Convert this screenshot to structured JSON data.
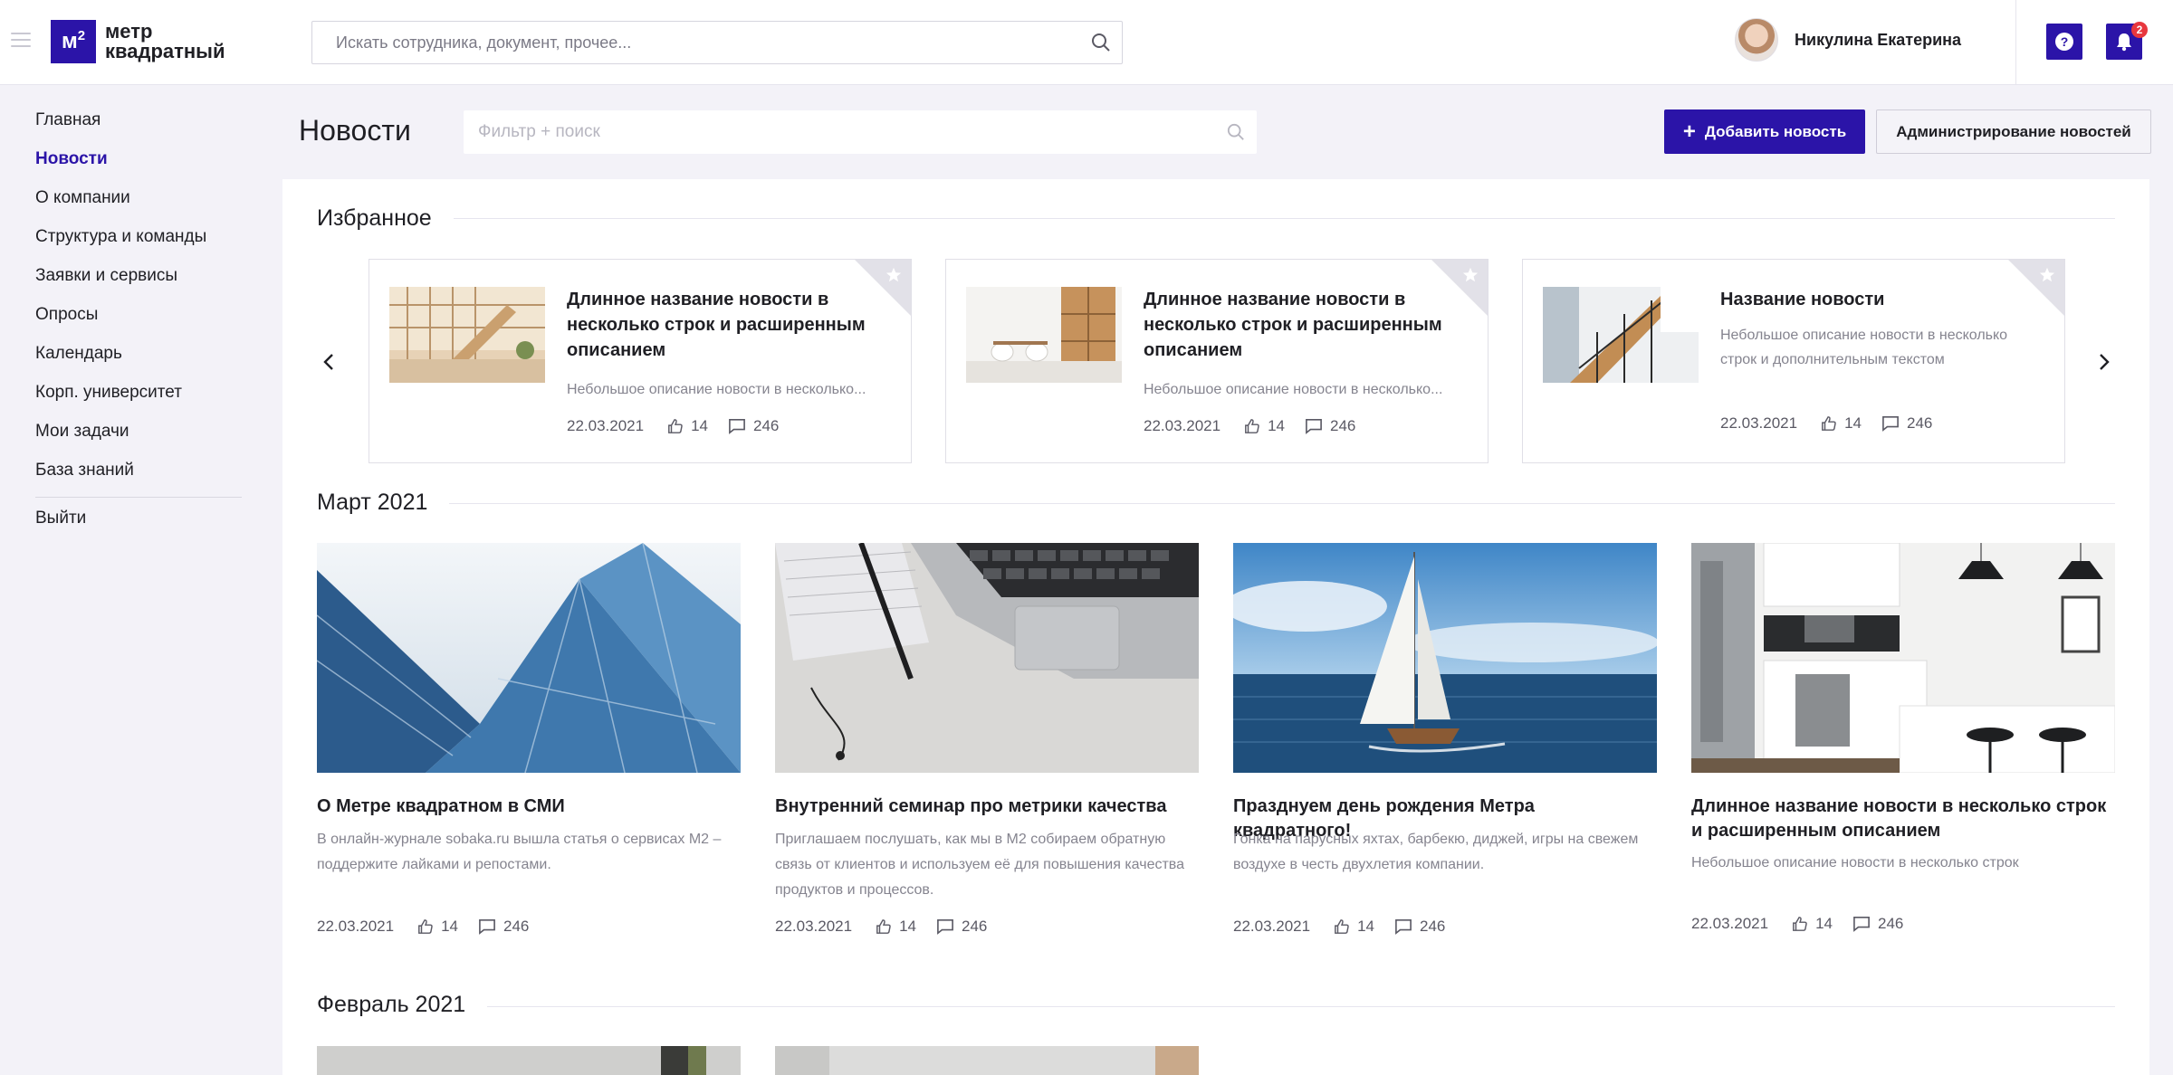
{
  "app": {
    "logo_line1": "метр",
    "logo_line2": "квадратный",
    "logo_mark": "м",
    "logo_sup": "2",
    "brand_color": "#2b14a8"
  },
  "header": {
    "search_placeholder": "Искать сотрудника, документ, прочее...",
    "user_name": "Никулина Екатерина",
    "help_label": "?",
    "notifications_count": "2"
  },
  "sidebar": {
    "items": [
      {
        "label": "Главная",
        "active": false
      },
      {
        "label": "Новости",
        "active": true
      },
      {
        "label": "О компании",
        "active": false
      },
      {
        "label": "Структура и команды",
        "active": false
      },
      {
        "label": "Заявки и сервисы",
        "active": false
      },
      {
        "label": "Опросы",
        "active": false
      },
      {
        "label": "Календарь",
        "active": false
      },
      {
        "label": "Корп. университет",
        "active": false
      },
      {
        "label": "Мои задачи",
        "active": false
      },
      {
        "label": "База знаний",
        "active": false
      }
    ],
    "logout_label": "Выйти"
  },
  "page": {
    "title": "Новости",
    "filter_placeholder": "Фильтр + поиск",
    "add_button": "Добавить новость",
    "admin_button": "Администрирование новостей"
  },
  "featured": {
    "title": "Избранное",
    "cards": [
      {
        "title": "Длинное название новости в несколько строк и расширенным описанием",
        "desc": "Небольшое описание новости в несколько...",
        "date": "22.03.2021",
        "likes": "14",
        "comments": "246",
        "image": "stairs-interior"
      },
      {
        "title": "Длинное название новости в несколько строк и расширенным описанием",
        "desc": "Небольшое описание новости в несколько...",
        "date": "22.03.2021",
        "likes": "14",
        "comments": "246",
        "image": "white-room"
      },
      {
        "title": "Название новости",
        "desc": "Небольшое описание новости в несколько строк и дополнительным текстом",
        "date": "22.03.2021",
        "likes": "14",
        "comments": "246",
        "image": "staircase"
      }
    ]
  },
  "march": {
    "title": "Март 2021",
    "cards": [
      {
        "title": "О Метре квадратном в СМИ",
        "desc": "В онлайн-журнале sobaka.ru вышла статья о сервисах М2 – поддержите лайками и репостами.",
        "date": "22.03.2021",
        "likes": "14",
        "comments": "246",
        "image": "skyscrapers"
      },
      {
        "title": "Внутренний семинар про метрики качества",
        "desc": "Приглашаем послушать, как мы в М2 собираем обратную связь от клиентов и используем её для повышения качества продуктов и процессов.",
        "date": "22.03.2021",
        "likes": "14",
        "comments": "246",
        "image": "laptop-desk"
      },
      {
        "title": "Празднуем день рождения Метра квадратного!",
        "desc": "Гонка на парусных яхтах, барбекю, диджей, игры на свежем воздухе в честь двухлетия компании.",
        "date": "22.03.2021",
        "likes": "14",
        "comments": "246",
        "image": "sailboat"
      },
      {
        "title": "Длинное название новости в несколько строк и расширенным описанием",
        "desc": "Небольшое описание новости в несколько строк",
        "date": "22.03.2021",
        "likes": "14",
        "comments": "246",
        "image": "kitchen"
      }
    ]
  },
  "february": {
    "title": "Февраль 2021"
  }
}
